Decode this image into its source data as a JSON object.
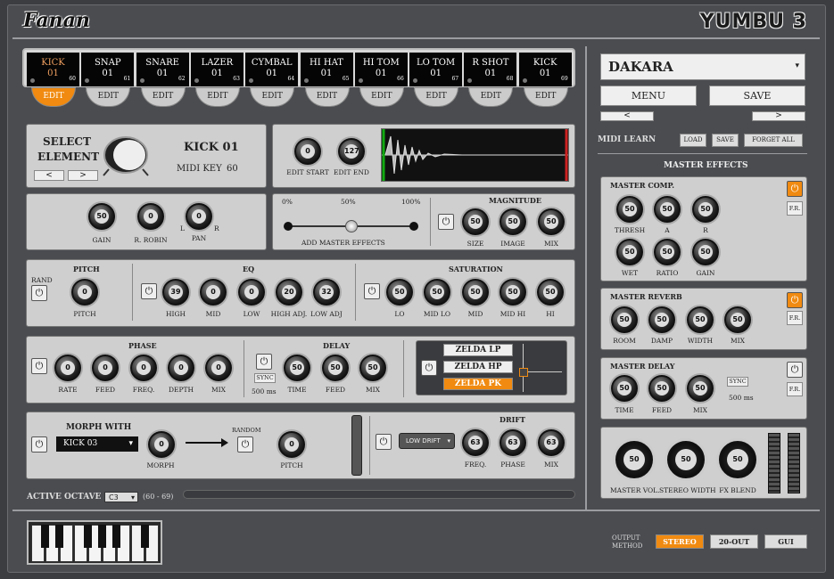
{
  "app": {
    "logo": "Fanan",
    "brand": "YUMBU 3"
  },
  "pads": [
    {
      "name": "KICK",
      "val": "01",
      "num": "60"
    },
    {
      "name": "SNAP",
      "val": "01",
      "num": "61"
    },
    {
      "name": "SNARE",
      "val": "01",
      "num": "62"
    },
    {
      "name": "LAZER",
      "val": "01",
      "num": "63"
    },
    {
      "name": "CYMBAL",
      "val": "01",
      "num": "64"
    },
    {
      "name": "HI HAT",
      "val": "01",
      "num": "65"
    },
    {
      "name": "HI TOM",
      "val": "01",
      "num": "66"
    },
    {
      "name": "LO TOM",
      "val": "01",
      "num": "67"
    },
    {
      "name": "R SHOT",
      "val": "01",
      "num": "68"
    },
    {
      "name": "KICK",
      "val": "01",
      "num": "69"
    }
  ],
  "edit_label": "EDIT",
  "select": {
    "title1": "SELECT",
    "title2": "ELEMENT",
    "prev": "<",
    "next": ">",
    "element": "KICK 01",
    "midikey_label": "MIDI KEY",
    "midikey": "60"
  },
  "sample": {
    "start": "0",
    "end": "127",
    "start_label": "EDIT START",
    "end_label": "EDIT END"
  },
  "mix": {
    "gain": "50",
    "robin": "0",
    "pan": "0",
    "gain_label": "GAIN",
    "robin_label": "R. ROBIN",
    "pan_label": "PAN",
    "l": "L",
    "r": "R"
  },
  "master_fx": {
    "p0": "0%",
    "p50": "50%",
    "p100": "100%",
    "label": "ADD MASTER EFFECTS"
  },
  "magnitude": {
    "title": "MAGNITUDE",
    "size": "50",
    "image": "50",
    "mix": "50",
    "size_label": "SIZE",
    "image_label": "IMAGE",
    "mix_label": "MIX"
  },
  "pitch": {
    "title": "PITCH",
    "rand": "RAND",
    "value": "0",
    "label": "PITCH"
  },
  "eq": {
    "title": "EQ",
    "high": "39",
    "mid": "0",
    "low": "0",
    "high_adj": "20",
    "low_adj": "32",
    "high_label": "HIGH",
    "mid_label": "MID",
    "low_label": "LOW",
    "high_adj_label": "HIGH ADJ.",
    "low_adj_label": "LOW ADJ"
  },
  "saturation": {
    "title": "SATURATION",
    "lo": "50",
    "midlo": "50",
    "mid": "50",
    "midhi": "50",
    "hi": "50",
    "lo_label": "LO",
    "midlo_label": "MID LO",
    "mid_label": "MID",
    "midhi_label": "MID HI",
    "hi_label": "HI"
  },
  "phase": {
    "title": "PHASE",
    "rate": "0",
    "feed": "0",
    "freq": "0",
    "depth": "0",
    "mix": "0",
    "rate_label": "RATE",
    "feed_label": "FEED",
    "freq_label": "FREQ.",
    "depth_label": "DEPTH",
    "mix_label": "MIX"
  },
  "delay": {
    "title": "DELAY",
    "sync": "SYNC",
    "ms": "500 ms",
    "time": "50",
    "feed": "50",
    "mix": "50",
    "time_label": "TIME",
    "feed_label": "FEED",
    "mix_label": "MIX"
  },
  "zelda": {
    "lp": "ZELDA LP",
    "hp": "ZELDA HP",
    "pk": "ZELDA PK"
  },
  "morph": {
    "title": "MORPH WITH",
    "target": "KICK 03",
    "value": "0",
    "label": "MORPH",
    "random": "RANDOM",
    "pitch": "0",
    "pitch_label": "PITCH"
  },
  "drift": {
    "title": "DRIFT",
    "mode": "LOW DRIFT",
    "freq": "63",
    "phase": "63",
    "mix": "63",
    "freq_label": "FREQ.",
    "phase_label": "PHASE",
    "mix_label": "MIX"
  },
  "octave": {
    "label": "ACTIVE OCTAVE",
    "value": "C3",
    "range": "(60 - 69)"
  },
  "preset": {
    "name": "DAKARA",
    "menu": "MENU",
    "save": "SAVE",
    "prev": "<",
    "next": ">"
  },
  "midi_learn": {
    "label": "MIDI LEARN",
    "load": "LOAD",
    "save": "SAVE",
    "forget": "FORGET ALL"
  },
  "master_effects_title": "MASTER EFFECTS",
  "comp": {
    "title": "MASTER COMP.",
    "fr": "F.R.",
    "thresh": "50",
    "a": "50",
    "r": "50",
    "wet": "50",
    "ratio": "50",
    "gain": "50",
    "thresh_label": "THRESH",
    "a_label": "A",
    "r_label": "R",
    "wet_label": "WET",
    "ratio_label": "RATIO",
    "gain_label": "GAIN"
  },
  "reverb": {
    "title": "MASTER REVERB",
    "fr": "F.R.",
    "room": "50",
    "damp": "50",
    "width": "50",
    "mix": "50",
    "room_label": "ROOM",
    "damp_label": "DAMP",
    "width_label": "WIDTH",
    "mix_label": "MIX"
  },
  "mdelay": {
    "title": "MASTER DELAY",
    "fr": "F.R.",
    "sync": "SYNC",
    "ms": "500 ms",
    "time": "50",
    "feed": "50",
    "mix": "50",
    "time_label": "TIME",
    "feed_label": "FEED",
    "mix_label": "MIX"
  },
  "master": {
    "vol": "50",
    "width": "50",
    "blend": "50",
    "vol_label": "MASTER VOL.",
    "width_label": "STEREO WIDTH",
    "blend_label": "FX BLEND"
  },
  "output": {
    "label1": "OUTPUT",
    "label2": "METHOD",
    "stereo": "STEREO",
    "out20": "20-OUT",
    "gui": "GUI"
  },
  "colors": {
    "accent": "#f08a10",
    "panel": "#cfcfcf",
    "bg": "#4a4c50"
  }
}
